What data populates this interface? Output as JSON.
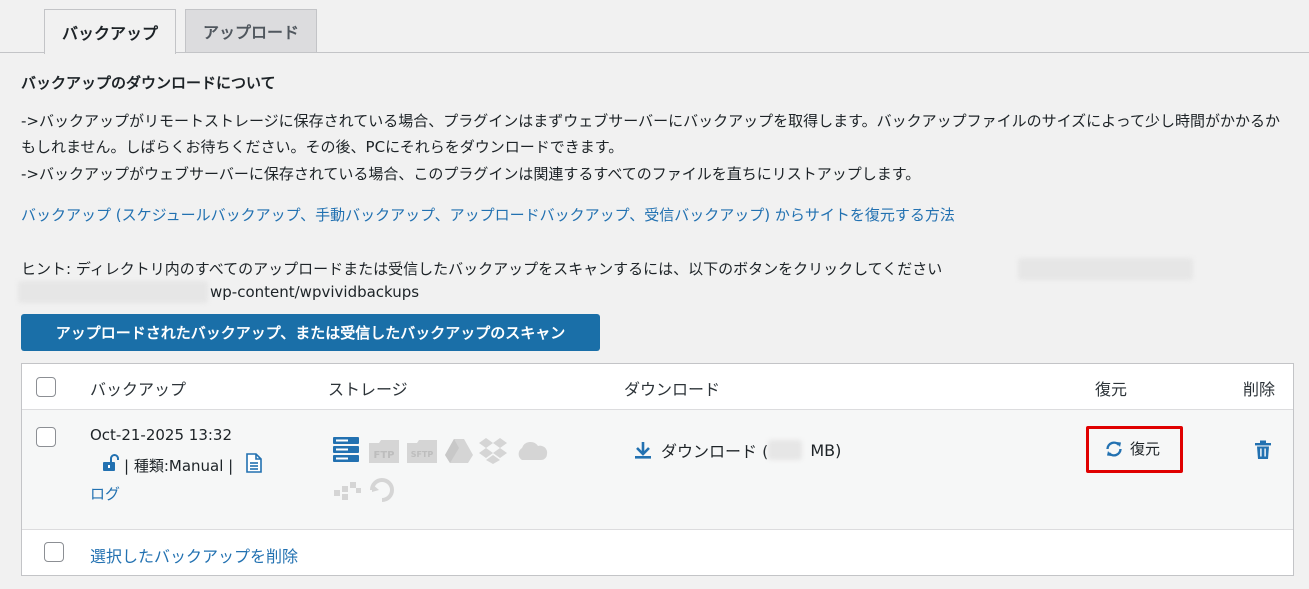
{
  "tabs": [
    {
      "label": "バックアップ",
      "active": true
    },
    {
      "label": "アップロード",
      "active": false
    }
  ],
  "section_title": "バックアップのダウンロードについて",
  "paragraph1": "->バックアップがリモートストレージに保存されている場合、プラグインはまずウェブサーバーにバックアップを取得します。バックアップファイルのサイズによって少し時間がかかるかもしれません。しばらくお待ちください。その後、PCにそれらをダウンロードできます。",
  "paragraph2": "->バックアップがウェブサーバーに保存されている場合、このプラグインは関連するすべてのファイルを直ちにリストアップします。",
  "howto_link": "バックアップ (スケジュールバックアップ、手動バックアップ、アップロードバックアップ、受信バックアップ) からサイトを復元する方法",
  "hint_text": "ヒント: ディレクトリ内のすべてのアップロードまたは受信したバックアップをスキャンするには、以下のボタンをクリックしてください",
  "hint_path": "wp-content/wpvividbackups",
  "scan_button": "アップロードされたバックアップ、または受信したバックアップのスキャン",
  "table": {
    "headers": {
      "backup": "バックアップ",
      "storage": "ストレージ",
      "download": "ダウンロード",
      "restore": "復元",
      "delete": "削除"
    },
    "rows": [
      {
        "date": "Oct-21-2025 13:32",
        "type": "| 種類:Manual |",
        "log": "ログ",
        "download_prefix": "ダウンロード (",
        "download_suffix": "MB)",
        "restore": "復元"
      }
    ],
    "footer_delete": "選択したバックアップを削除"
  },
  "storage_labels": {
    "ftp": "FTP",
    "sftp": "SFTP"
  },
  "colors": {
    "accent": "#2271b1",
    "button": "#1a6fa8",
    "highlight": "#e00000",
    "storage_active": "#2271b1",
    "storage_inactive": "#d0d0d0"
  }
}
